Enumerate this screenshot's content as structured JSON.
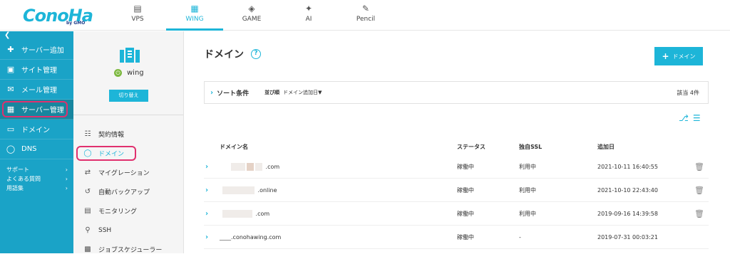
{
  "brand": {
    "logo": "ConoHa",
    "sub": "by GMO"
  },
  "topnav": [
    {
      "label": "VPS",
      "icon": "server-icon"
    },
    {
      "label": "WING",
      "icon": "wing-icon"
    },
    {
      "label": "GAME",
      "icon": "gamepad-icon"
    },
    {
      "label": "AI",
      "icon": "ai-chip-icon"
    },
    {
      "label": "Pencil",
      "icon": "pencil-icon"
    }
  ],
  "sidebar": {
    "items": [
      {
        "label": "サーバー追加",
        "icon": "plus-icon"
      },
      {
        "label": "サイト管理",
        "icon": "window-icon"
      },
      {
        "label": "メール管理",
        "icon": "mail-icon"
      },
      {
        "label": "サーバー管理",
        "icon": "server-manage-icon"
      },
      {
        "label": "ドメイン",
        "icon": "domain-card-icon"
      },
      {
        "label": "DNS",
        "icon": "globe-icon"
      }
    ],
    "links": [
      {
        "label": "サポート"
      },
      {
        "label": "よくある質問"
      },
      {
        "label": "用語集"
      }
    ]
  },
  "panel2": {
    "server_name": "wing",
    "switch_label": "切り替え",
    "items": [
      {
        "label": "契約情報",
        "icon": "contract-icon"
      },
      {
        "label": "ドメイン",
        "icon": "globe-icon"
      },
      {
        "label": "マイグレーション",
        "icon": "migration-icon"
      },
      {
        "label": "自動バックアップ",
        "icon": "backup-icon"
      },
      {
        "label": "モニタリング",
        "icon": "monitor-icon"
      },
      {
        "label": "SSH",
        "icon": "key-icon"
      },
      {
        "label": "ジョブスケジューラー",
        "icon": "scheduler-icon"
      }
    ]
  },
  "main": {
    "title": "ドメイン",
    "add_label": "ドメイン",
    "sort": {
      "label": "ソート条件",
      "order_label": "並び順",
      "order_value": "ドメイン追加日▼",
      "count": "該当 4件"
    },
    "headers": {
      "name": "ドメイン名",
      "status": "ステータス",
      "ssl": "独自SSL",
      "date": "追加日"
    },
    "rows": [
      {
        "name": ".com",
        "status": "稼働中",
        "ssl": "利用中",
        "date": "2021-10-11 16:40:55"
      },
      {
        "name": ".online",
        "status": "稼働中",
        "ssl": "利用中",
        "date": "2021-10-10 22:43:40"
      },
      {
        "name": ".com",
        "status": "稼働中",
        "ssl": "利用中",
        "date": "2019-09-16 14:39:58"
      },
      {
        "name": "____.conohawing.com",
        "status": "稼働中",
        "ssl": "-",
        "date": "2019-07-31 00:03:21"
      }
    ]
  },
  "colors": {
    "accent": "#1db5d8",
    "sidebar": "#1aa3c7",
    "highlight": "#e0306e",
    "power": "#7cb83f"
  }
}
